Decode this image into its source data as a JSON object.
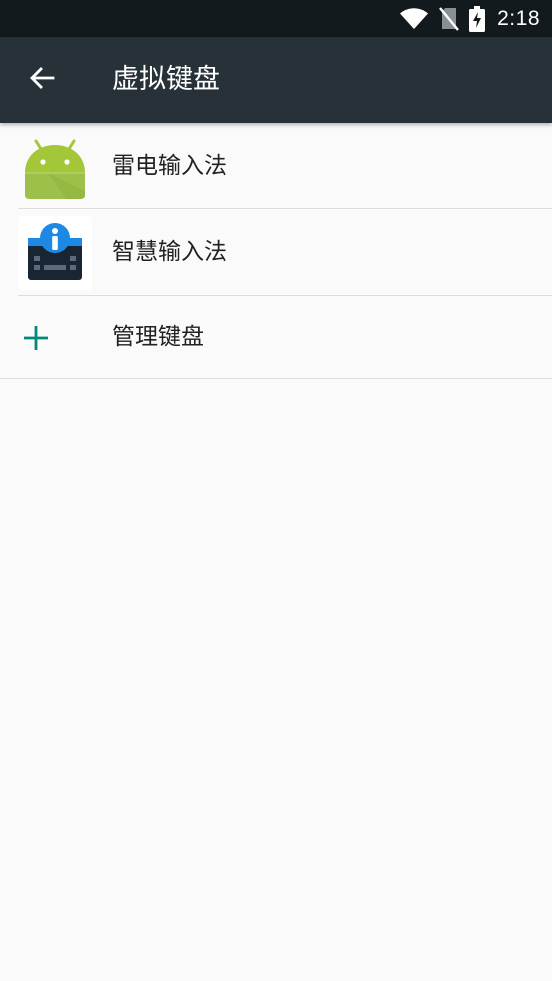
{
  "status_bar": {
    "time": "2:18",
    "icons": [
      "wifi-icon",
      "no-sim-icon",
      "battery-charging-icon"
    ]
  },
  "app_bar": {
    "title": "虚拟键盘",
    "back_icon": "arrow-back-icon"
  },
  "keyboards": [
    {
      "label": "雷电输入法",
      "icon": "android-icon",
      "color": "#a4c639"
    },
    {
      "label": "智慧输入法",
      "icon": "smart-keyboard-icon",
      "color": "#1e88e5"
    }
  ],
  "manage": {
    "label": "管理键盘",
    "icon": "plus-icon",
    "color": "#00897b"
  }
}
